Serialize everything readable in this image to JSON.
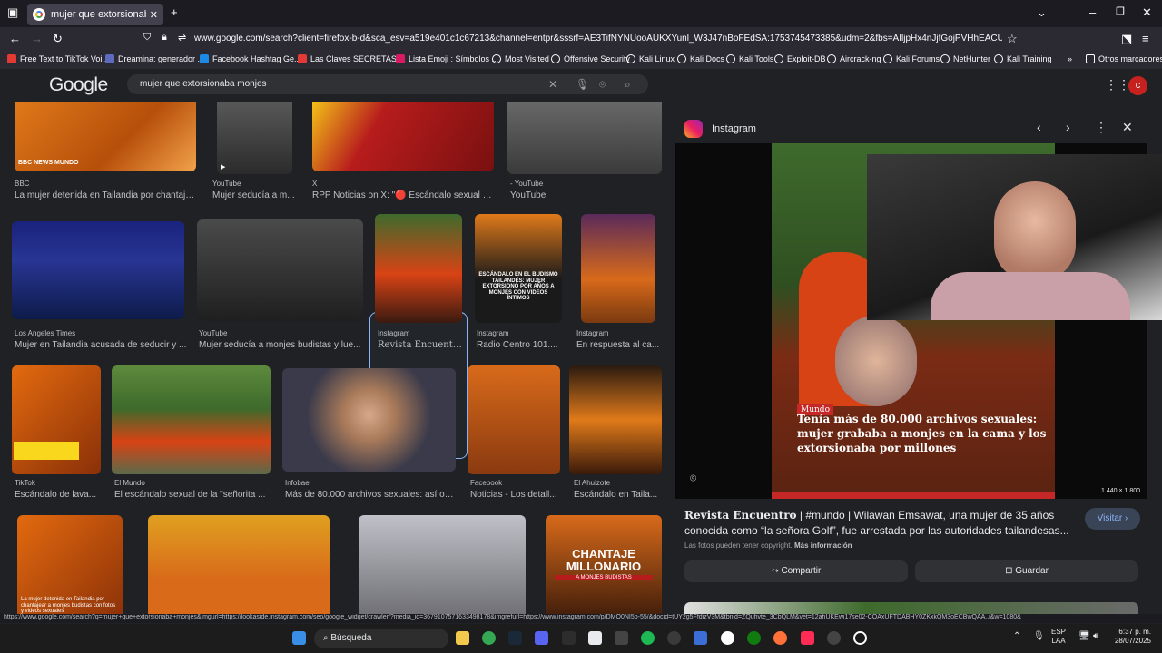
{
  "browser": {
    "tab_title": "mujer que extorsionaba monje",
    "url": "www.google.com/search?client=firefox-b-d&sca_esv=a519e401c1c67213&channel=entpr&sssrf=AE3TifNYNUooAUKXYunl_W3J47nBoFEdSA:1753745473385&udm=2&fbs=AIljpHx4nJjfGojPVHhEACUHPiMQht6_BFq6vBlo",
    "bookmarks": [
      "Free Text to TikTok Voi...",
      "Dreamina: generador ...",
      "Facebook Hashtag Ge...",
      "Las Claves SECRETAS ...",
      "Lista Emoji : Símbolos ...",
      "Most Visited",
      "Offensive Security",
      "Kali Linux",
      "Kali Docs",
      "Kali Tools",
      "Exploit-DB",
      "Aircrack-ng",
      "Kali Forums",
      "NetHunter",
      "Kali Training"
    ],
    "other_bookmarks": "Otros marcadores",
    "status_url": "https://www.google.com/search?q=mujer+que+extorsionaba+monjes&imgurl=https://lookaside.instagram.com/seo/google_widget/crawler/?media_id=3679107571633498178&imgrefurl=https://www.instagram.com/p/DMO0NI5p-55/&docid=tUY2g5FfdizV3M&tbnid=ZQuhvte_3CbQLM&vet=12ahUKEwi17se02-COAxUFTDABHY0ZKxkQM3oECBwQAA..i&w=1080&"
  },
  "google": {
    "logo": "Google",
    "query": "mujer que extorsionaba monjes",
    "avatar_letter": "c"
  },
  "results": [
    {
      "source": "BBC",
      "title": "La mujer detenida en Tailandia por chantaje..."
    },
    {
      "source": "YouTube",
      "title": "Mujer seducía a m..."
    },
    {
      "source": "X",
      "title": "RPP Noticias on X: \"🔴 Escándalo sexual e..."
    },
    {
      "source": "- YouTube",
      "title": "YouTube"
    },
    {
      "source": "Los Angeles Times",
      "title": "Mujer en Tailandia acusada de seducir y ..."
    },
    {
      "source": "YouTube",
      "title": "Mujer seducía a monjes budistas y lue..."
    },
    {
      "source": "Instagram",
      "title": "Revista Encuentr..."
    },
    {
      "source": "Instagram",
      "title": "Radio Centro 101...."
    },
    {
      "source": "Instagram",
      "title": "En respuesta al ca..."
    },
    {
      "source": "TikTok",
      "title": "Escándalo de lava..."
    },
    {
      "source": "El Mundo",
      "title": "El escándalo sexual de la \"señorita ..."
    },
    {
      "source": "Infobae",
      "title": "Más de 80.000 archivos sexuales: así op..."
    },
    {
      "source": "Facebook",
      "title": "Noticias - Los detall..."
    },
    {
      "source": "El Ahuizote",
      "title": "Escándalo en Taila..."
    }
  ],
  "thumb_text": {
    "bbc": "BBC NEWS MUNDO",
    "escandalo": "ESCÁNDALO EN EL BUDISMO TAILANDÉS: MUJER EXTORSIONÓ POR AÑOS A MONJES CON VIDEOS ÍNTIMOS",
    "chantaje": "CHANTAJE MILLONARIO",
    "chantaje_sub": "A MONJES BUDISTAS",
    "detenida": "La mujer detenida en Tailandia por chantajear a monjes budistas con fotos y videos sexuales"
  },
  "panel": {
    "source": "Instagram",
    "tag": "Mundo",
    "image_caption": "Tenía más de 80.000 archivos sexuales: mujer grababa a monjes en la cama y los extorsionaba por millones",
    "dimensions": "1.440 × 1.800",
    "title": "Revista Encuentro",
    "description": " | #mundo | Wilawan Emsawat, una mujer de 35 años conocida como “la señora Golf”, fue arrestada por las autoridades tailandesas...",
    "visit": "Visitar",
    "copyright": "Las fotos pueden tener copyright.",
    "more_info": "Más información",
    "share": "Compartir",
    "save": "Guardar"
  },
  "taskbar": {
    "search": "Búsqueda",
    "lang_1": "ESP",
    "lang_2": "LAA",
    "time": "6:37 p. m.",
    "date": "28/07/2025"
  },
  "colors": {
    "accent": "#8ab4f8",
    "background": "#202124",
    "robe": "#d8610f"
  }
}
